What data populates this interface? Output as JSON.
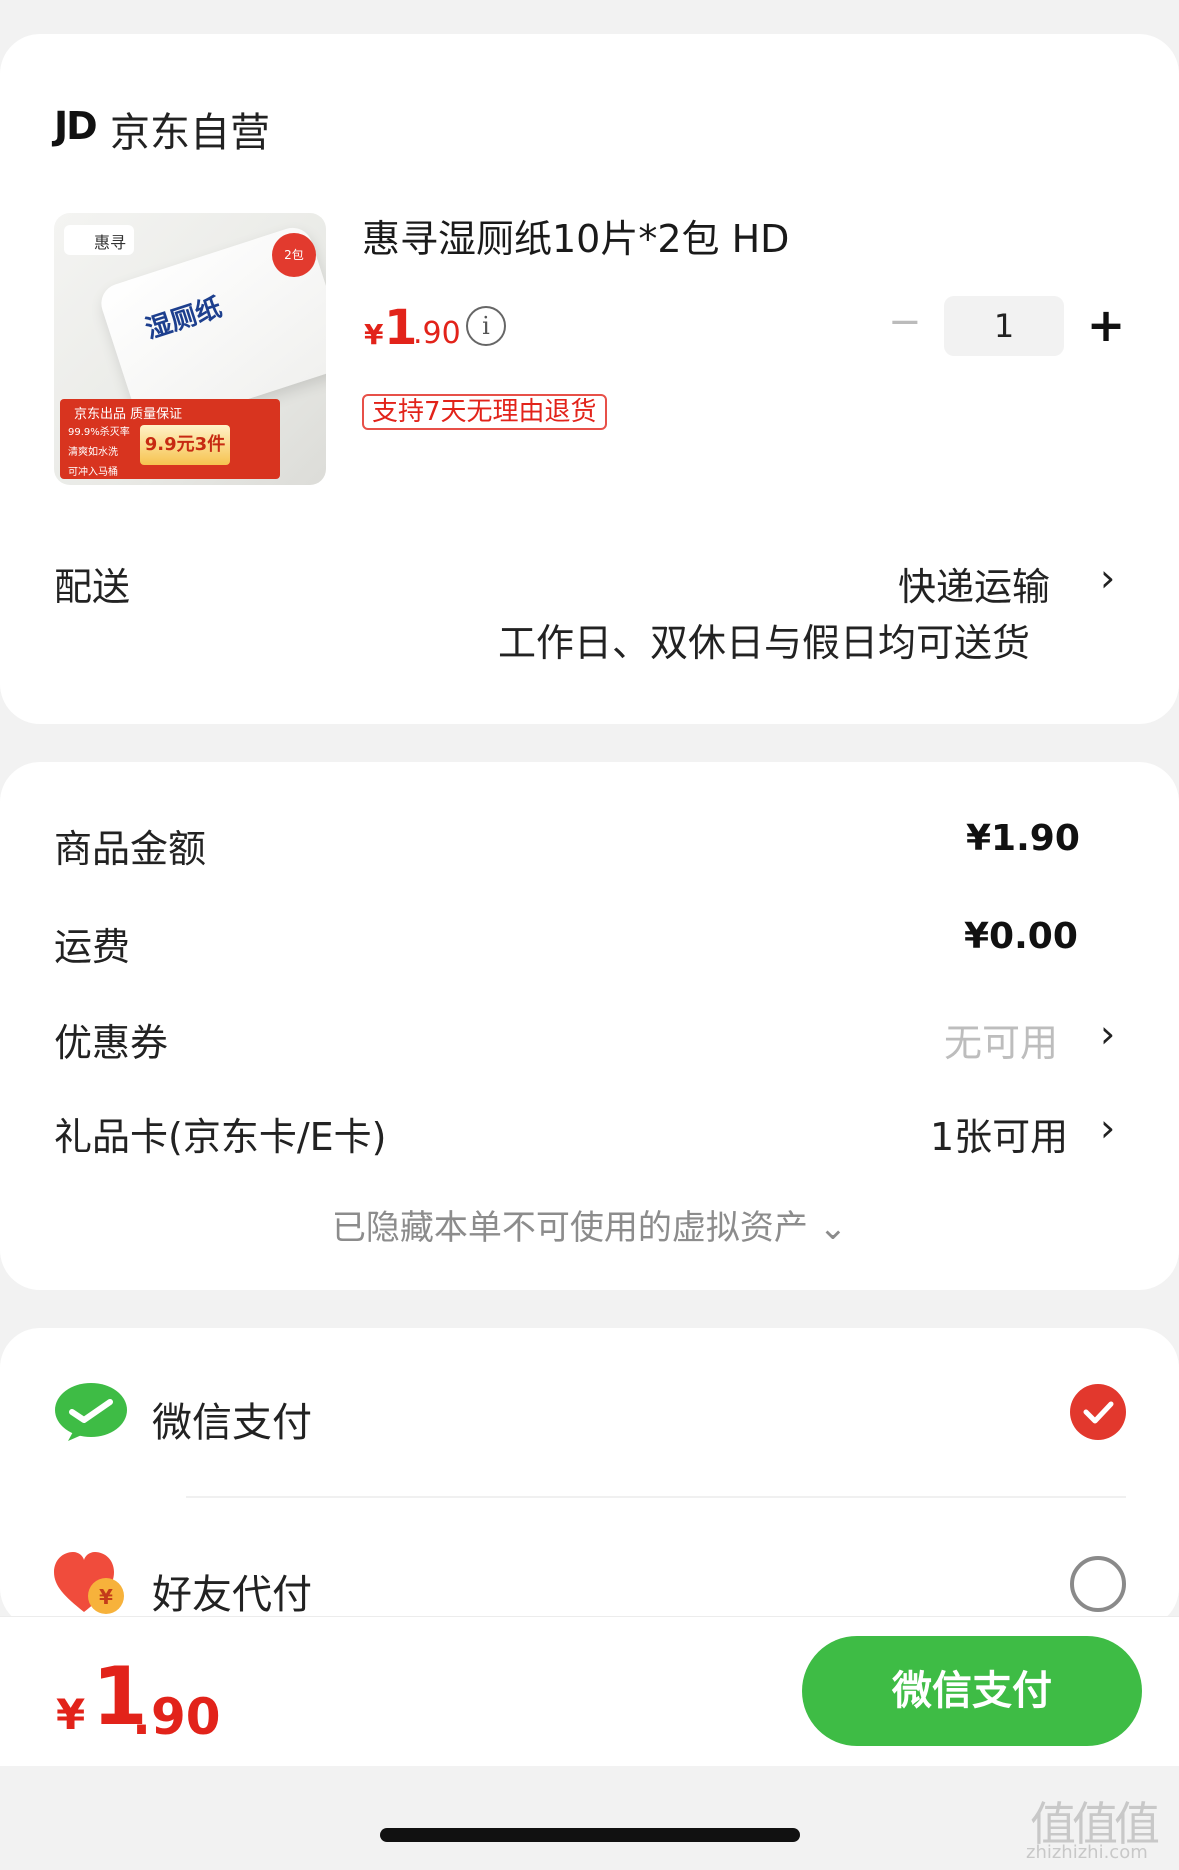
{
  "shop": {
    "logo": "JD",
    "name": "京东自营"
  },
  "product": {
    "title": "惠寻湿厕纸10片*2包 HD",
    "price_symbol": "¥",
    "price_integer": "1",
    "price_decimal": ".90",
    "quantity": "1",
    "return_policy": "支持7天无理由退货",
    "image": {
      "brand": "惠寻",
      "brand_mark": "H",
      "pack_text": "湿厕纸",
      "badge": "2包",
      "promo_title": "京东出品 质量保证",
      "promo_lines": [
        "99.9%杀灭率",
        "清爽如水洗",
        "可冲入马桶"
      ],
      "promo_price": "9.9元3件"
    }
  },
  "delivery": {
    "label": "配送",
    "method": "快递运输",
    "note": "工作日、双休日与假日均可送货"
  },
  "amounts": {
    "goods_label": "商品金额",
    "goods_value": "¥1.90",
    "shipping_label": "运费",
    "shipping_value": "¥0.00",
    "coupon_label": "优惠券",
    "coupon_value": "无可用",
    "giftcard_label": "礼品卡(京东卡/E卡)",
    "giftcard_value": "1张可用",
    "hidden_note": "已隐藏本单不可使用的虚拟资产 ⌄"
  },
  "payment": {
    "wechat_label": "微信支付",
    "friend_label": "好友代付",
    "selected": "wechat"
  },
  "footer": {
    "total_symbol": "¥",
    "total_integer": "1",
    "total_decimal": ".90",
    "pay_button": "微信支付"
  },
  "watermark": {
    "glyph": "值值值",
    "url": "zhizhizhi.com"
  },
  "icons": {
    "info": "info-icon",
    "chevron": "chevron-right-icon",
    "wechat": "wechat-pay-icon",
    "friend": "heart-yuan-icon",
    "check": "check-icon"
  },
  "colors": {
    "accent_red": "#e2231a",
    "wechat_green": "#3ebc45",
    "page_bg": "#f2f2f2"
  }
}
